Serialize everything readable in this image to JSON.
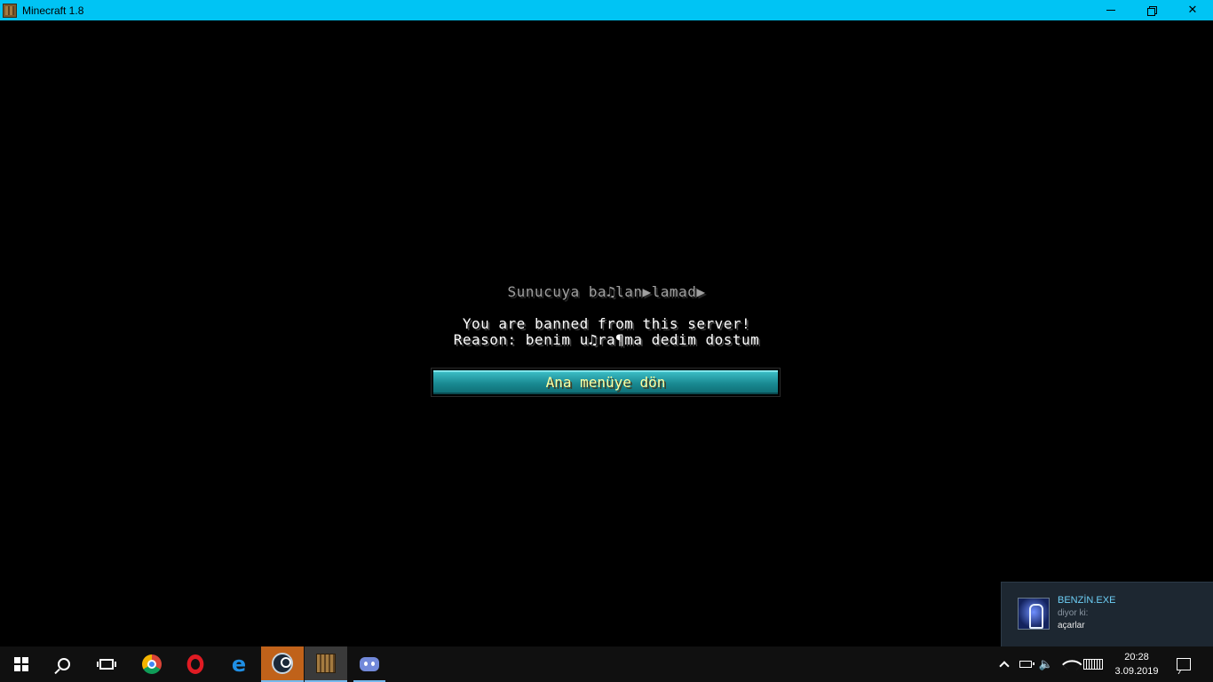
{
  "window": {
    "title": "Minecraft 1.8",
    "icon": "minecraft-icon",
    "controls": {
      "close_glyph": "✕"
    }
  },
  "game": {
    "disconnect_title": "Sunucuya ba♫lan▶lamad▶",
    "ban_message_line1": "You are banned from this server!",
    "ban_message_line2": "Reason: benim u♫ra¶ma dedim dostum",
    "back_button_label": "Ana menüye dön",
    "colors": {
      "button_text": "#ffffa0",
      "button_bg": "#1a8a92",
      "title_text": "#a0a0a0"
    }
  },
  "notification": {
    "sender": "BENZİN.EXE",
    "subtitle": "diyor ki:",
    "message": "açarlar",
    "avatar_icon": "avatar-icon"
  },
  "taskbar": {
    "apps": [
      {
        "name": "start",
        "icon": "windows-logo-icon"
      },
      {
        "name": "search",
        "icon": "search-icon"
      },
      {
        "name": "task-view",
        "icon": "task-view-icon"
      },
      {
        "name": "chrome",
        "icon": "chrome-icon"
      },
      {
        "name": "opera",
        "icon": "opera-icon"
      },
      {
        "name": "edge",
        "icon": "edge-icon",
        "glyph": "e"
      },
      {
        "name": "steam",
        "icon": "steam-icon",
        "state": "active"
      },
      {
        "name": "minecraft",
        "icon": "minecraft-icon",
        "state": "active"
      },
      {
        "name": "discord",
        "icon": "discord-icon",
        "state": "running"
      }
    ],
    "tray": {
      "volume_glyph": "🔈",
      "time": "20:28",
      "date": "3.09.2019"
    }
  }
}
